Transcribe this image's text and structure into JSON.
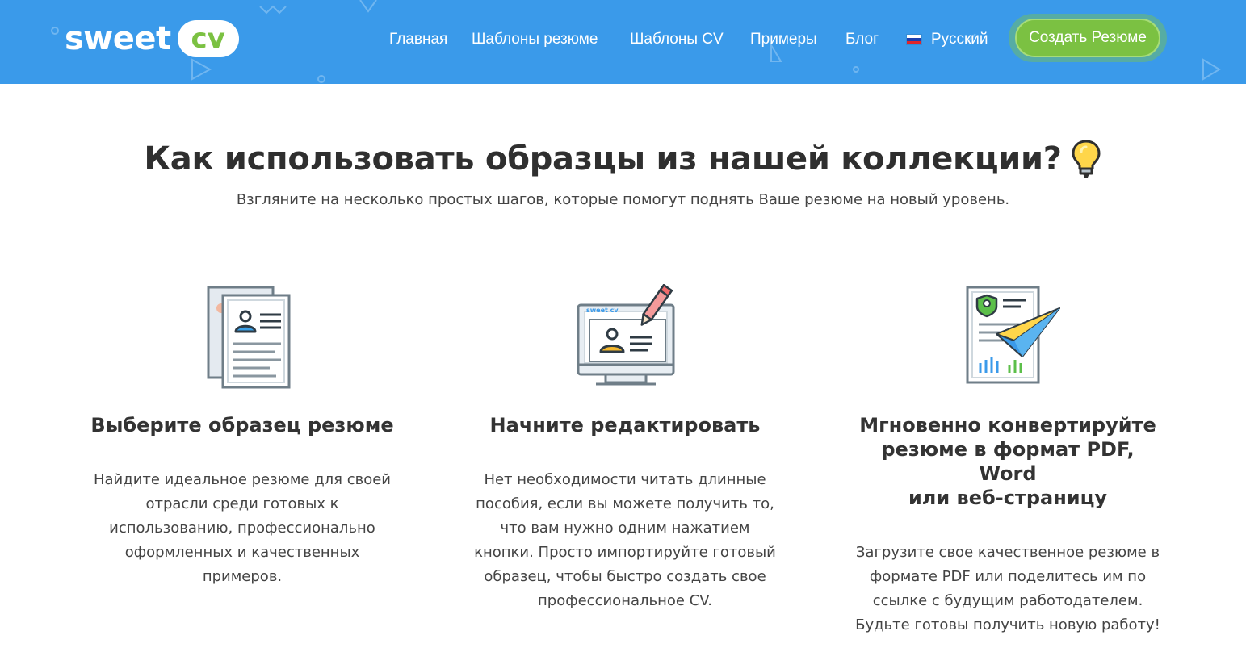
{
  "header": {
    "logo": {
      "word": "sweet",
      "badge": "cv"
    },
    "nav": [
      {
        "label": "Главная"
      },
      {
        "label": "Шаблоны резюме"
      },
      {
        "label": "Шаблоны CV"
      },
      {
        "label": "Примеры"
      },
      {
        "label": "Блог"
      }
    ],
    "language": {
      "label": "Русский",
      "flag_icon": "russia-flag-icon"
    },
    "cta_label": "Создать Резюме",
    "colors": {
      "background": "#3a9aea",
      "cta": "#7bc142"
    }
  },
  "section": {
    "title": "Как использовать образцы из нашей коллекции?",
    "title_icon": "lightbulb-icon",
    "subtitle": "Взгляните на несколько простых шагов, которые помогут поднять Ваше резюме на новый уровень."
  },
  "features": [
    {
      "icon": "resume-documents-icon",
      "title": "Выберите образец резюме",
      "text_lines": [
        "Найдите идеальное резюме для своей",
        "отрасли среди готовых к",
        "использованию, профессионально",
        "оформленных и качественных",
        "примеров."
      ]
    },
    {
      "icon": "monitor-edit-icon",
      "icon_label": "sweet cv",
      "title": "Начните редактировать",
      "text_lines": [
        "Нет необходимости читать длинные",
        "пособия, если вы можете получить то,",
        "что вам нужно одним нажатием",
        "кнопки. Просто импортируйте готовый",
        "образец, чтобы быстро создать свое",
        "профессиональное CV."
      ]
    },
    {
      "icon": "document-paper-plane-icon",
      "title_lines": [
        "Мгновенно конвертируйте",
        "резюме в формат PDF, Word",
        "или веб-страницу"
      ],
      "text_lines": [
        "Загрузите свое качественное резюме в",
        "формате PDF или поделитесь им по",
        "ссылке с будущим работодателем.",
        "Будьте готовы получить новую работу!"
      ]
    }
  ]
}
